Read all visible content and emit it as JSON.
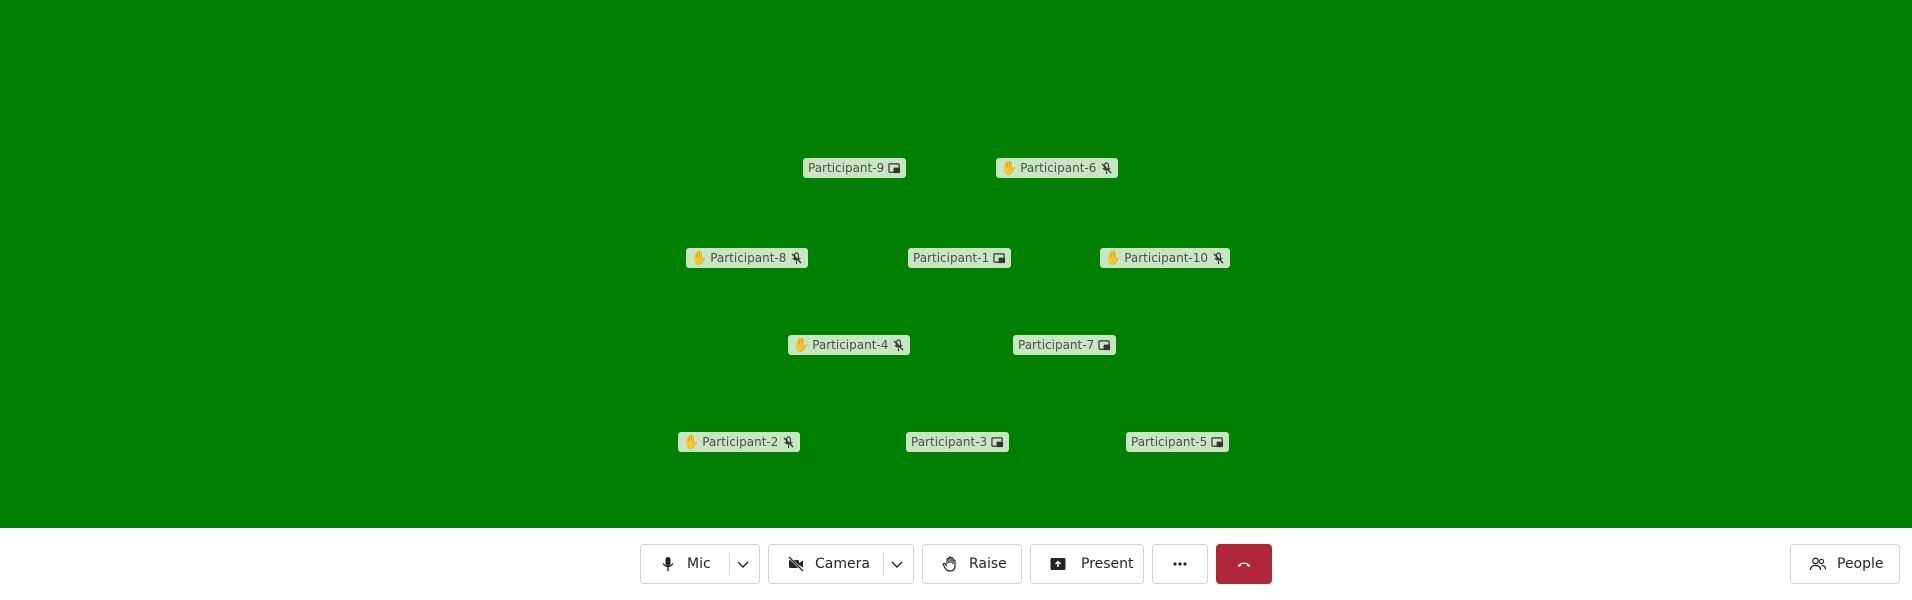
{
  "participants": [
    {
      "name": "Participant-9",
      "hand_raised": false,
      "status": "screen-share"
    },
    {
      "name": "Participant-6",
      "hand_raised": true,
      "status": "mic-muted"
    },
    {
      "name": "Participant-8",
      "hand_raised": true,
      "status": "mic-muted"
    },
    {
      "name": "Participant-1",
      "hand_raised": false,
      "status": "screen-share"
    },
    {
      "name": "Participant-10",
      "hand_raised": true,
      "status": "mic-muted"
    },
    {
      "name": "Participant-4",
      "hand_raised": true,
      "status": "mic-muted"
    },
    {
      "name": "Participant-7",
      "hand_raised": false,
      "status": "screen-share"
    },
    {
      "name": "Participant-2",
      "hand_raised": true,
      "status": "mic-muted"
    },
    {
      "name": "Participant-3",
      "hand_raised": false,
      "status": "screen-share"
    },
    {
      "name": "Participant-5",
      "hand_raised": false,
      "status": "screen-share"
    }
  ],
  "toolbar": {
    "mic_label": "Mic",
    "camera_label": "Camera",
    "raise_label": "Raise",
    "present_label": "Present",
    "more_label": "...",
    "people_label": "People"
  },
  "colors": {
    "stage_background": "#008000",
    "hangup": "#b12638",
    "tag_background": "#c8e6c1"
  }
}
